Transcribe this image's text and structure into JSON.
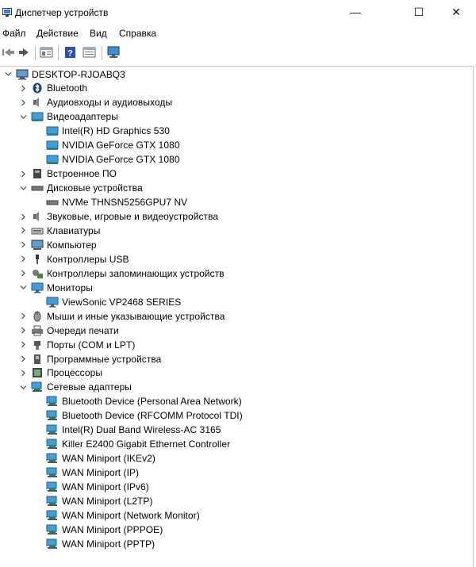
{
  "window": {
    "title": "Диспетчер устройств",
    "controls": {
      "minimize": "—",
      "maximize": "☐",
      "close": "✕"
    }
  },
  "menu": [
    "Файл",
    "Действие",
    "Вид",
    "Справка"
  ],
  "toolbar": {
    "buttons": [
      "back-icon",
      "forward-icon",
      "properties-icon",
      "help-icon",
      "view-icon",
      "monitor-icon"
    ]
  },
  "tree": {
    "root": "DESKTOP-RJOABQ3",
    "items": [
      {
        "label": "Bluetooth",
        "icon": "bluetooth-icon",
        "expanded": false
      },
      {
        "label": "Аудиовходы и аудиовыходы",
        "icon": "audio-icon",
        "expanded": false
      },
      {
        "label": "Видеоадаптеры",
        "icon": "display-adapter-icon",
        "expanded": true,
        "children": [
          "Intel(R) HD Graphics 530",
          "NVIDIA GeForce GTX 1080",
          "NVIDIA GeForce GTX 1080"
        ]
      },
      {
        "label": "Встроенное ПО",
        "icon": "firmware-icon",
        "expanded": false
      },
      {
        "label": "Дисковые устройства",
        "icon": "disk-icon",
        "expanded": true,
        "children": [
          "NVMe THNSN5256GPU7 NV"
        ]
      },
      {
        "label": "Звуковые, игровые и видеоустройства",
        "icon": "sound-icon",
        "expanded": false
      },
      {
        "label": "Клавиатуры",
        "icon": "keyboard-icon",
        "expanded": false
      },
      {
        "label": "Компьютер",
        "icon": "computer-icon",
        "expanded": false
      },
      {
        "label": "Контроллеры USB",
        "icon": "usb-icon",
        "expanded": false
      },
      {
        "label": "Контроллеры запоминающих устройств",
        "icon": "storage-controller-icon",
        "expanded": false
      },
      {
        "label": "Мониторы",
        "icon": "monitor-icon",
        "expanded": true,
        "children": [
          "ViewSonic VP2468 SERIES"
        ]
      },
      {
        "label": "Мыши и иные указывающие устройства",
        "icon": "mouse-icon",
        "expanded": false
      },
      {
        "label": "Очереди печати",
        "icon": "printer-icon",
        "expanded": false
      },
      {
        "label": "Порты (COM и LPT)",
        "icon": "port-icon",
        "expanded": false
      },
      {
        "label": "Программные устройства",
        "icon": "software-device-icon",
        "expanded": false
      },
      {
        "label": "Процессоры",
        "icon": "processor-icon",
        "expanded": false
      },
      {
        "label": "Сетевые адаптеры",
        "icon": "network-adapter-icon",
        "expanded": true,
        "children": [
          "Bluetooth Device (Personal Area Network)",
          "Bluetooth Device (RFCOMM Protocol TDI)",
          "Intel(R) Dual Band Wireless-AC 3165",
          "Killer E2400 Gigabit Ethernet Controller",
          "WAN Miniport (IKEv2)",
          "WAN Miniport (IP)",
          "WAN Miniport (IPv6)",
          "WAN Miniport (L2TP)",
          "WAN Miniport (Network Monitor)",
          "WAN Miniport (PPPOE)",
          "WAN Miniport (PPTP)"
        ]
      }
    ]
  },
  "colors": {
    "accent": "#1e88d8",
    "background": "#ffffff",
    "text": "#000000"
  }
}
